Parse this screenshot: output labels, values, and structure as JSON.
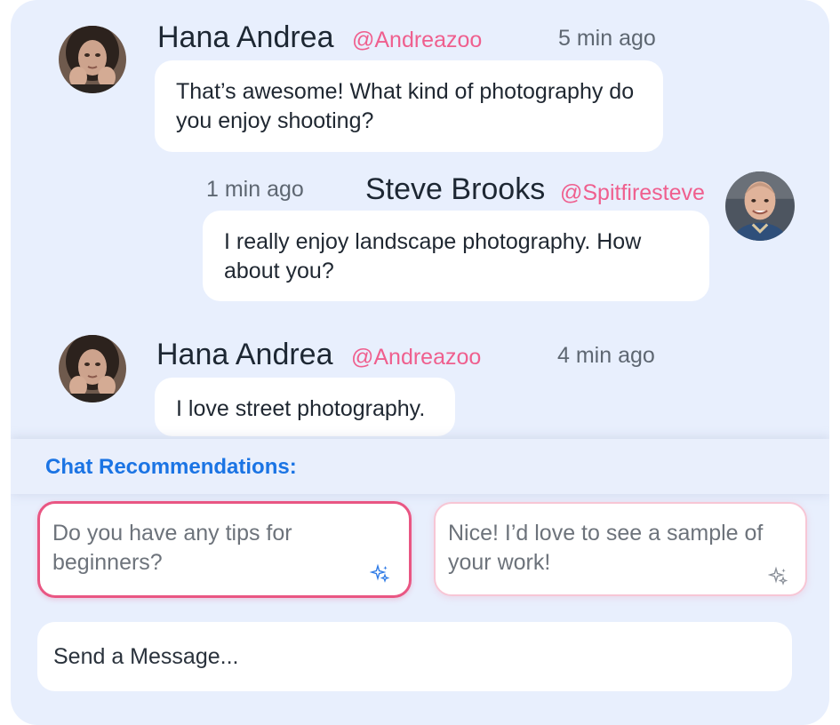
{
  "messages": [
    {
      "author": "Hana Andrea",
      "handle": "@Andreazoo",
      "time": "5 min ago",
      "text": "That’s awesome! What kind of photography do you enjoy shooting?",
      "avatar_icon": "user-avatar-hana"
    },
    {
      "author": "Steve Brooks",
      "handle": "@Spitfiresteve",
      "time": "1 min ago",
      "text": "I really enjoy landscape photography. How about you?",
      "avatar_icon": "user-avatar-steve"
    },
    {
      "author": "Hana Andrea",
      "handle": "@Andreazoo",
      "time": "4 min ago",
      "text": "I love street photography.",
      "avatar_icon": "user-avatar-hana"
    }
  ],
  "recommendations": {
    "title": "Chat Recommendations:",
    "items": [
      {
        "text": "Do you have any tips for beginners?",
        "icon": "sparkle-icon"
      },
      {
        "text": "Nice! I’d love to see a sample of your work!",
        "icon": "sparkle-icon"
      }
    ]
  },
  "composer": {
    "placeholder": "Send a Message..."
  },
  "colors": {
    "panel_bg": "#e8effd",
    "handle": "#ef5f8e",
    "accent_blue": "#1b74e4",
    "active_border": "#e95683"
  }
}
